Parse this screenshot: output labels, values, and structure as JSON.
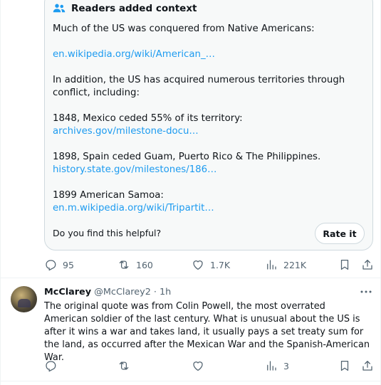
{
  "context_card": {
    "title": "Readers added context",
    "intro": "Much of the US was conquered from Native Americans:",
    "link1": "en.wikipedia.org/wiki/American_…",
    "para2": "In addition, the US has acquired numerous territories through conflict, including:",
    "item1_text": "1848, Mexico ceded 55% of its territory:",
    "item1_link": "archives.gov/milestone-docu…",
    "item2_text": "1898, Spain ceded Guam, Puerto Rico & The Philippines.",
    "item2_link": "history.state.gov/milestones/186…",
    "item3_text": "1899 American Samoa:",
    "item3_link": "en.m.wikipedia.org/wiki/Tripartit…",
    "helpful_question": "Do you find this helpful?",
    "rate_button": "Rate it"
  },
  "main_actions": {
    "replies": "95",
    "reposts": "160",
    "likes": "1.7K",
    "views": "221K"
  },
  "reply": {
    "name": "McClarey",
    "handle": "@McClarey2",
    "dot": "·",
    "time": "1h",
    "text": "The original quote was from Colin Powell, the most overrated American soldier of the last century.  What is unusual about the US is after it wins a war and takes land, it usually pays a set treaty sum for the land, as occurred after the Mexican War and the Spanish-American War.",
    "actions": {
      "replies": "",
      "reposts": "",
      "likes": "",
      "views": "3"
    }
  },
  "icons": {
    "context": "people-icon",
    "reply": "reply-icon",
    "repost": "repost-icon",
    "like": "heart-icon",
    "views": "views-icon",
    "bookmark": "bookmark-icon",
    "share": "share-icon",
    "more": "more-icon"
  },
  "colors": {
    "link": "#1d9bf0",
    "muted": "#536471",
    "text": "#0f1419",
    "card_bg": "#f7f9f9",
    "border": "#cfd9de"
  }
}
